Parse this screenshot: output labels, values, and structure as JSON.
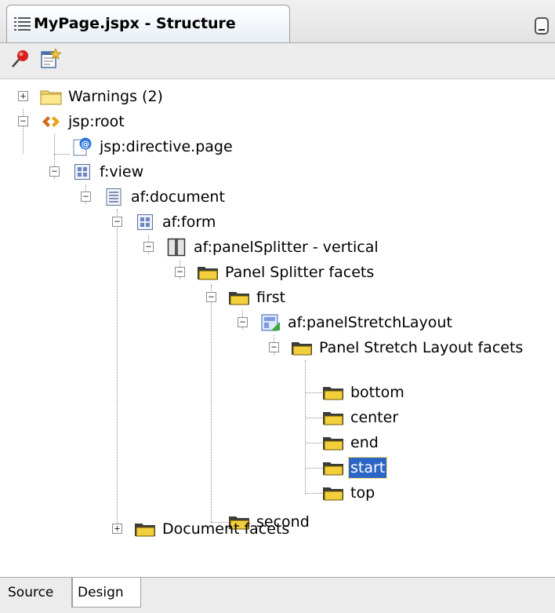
{
  "window": {
    "tab_title": "MyPage.jspx - Structure",
    "tab_icon": "structure-icon",
    "minimize_icon": "minimize-icon"
  },
  "toolbar": {
    "buttons": [
      {
        "icon": "pin-icon",
        "color": "#d42020"
      },
      {
        "icon": "new-view-icon",
        "color": "#f0c040"
      }
    ]
  },
  "tree": {
    "selected_color": "#2b65c6",
    "nodes": [
      {
        "label": "Warnings (2)",
        "icon": "folder-icon",
        "expander": "+"
      },
      {
        "label": "jsp:root",
        "icon": "xml-tag-icon",
        "expander": "-"
      },
      {
        "label": "jsp:directive.page",
        "icon": "directive-icon",
        "expander": ""
      },
      {
        "label": "f:view",
        "icon": "component-grid-icon",
        "expander": "-"
      },
      {
        "label": "af:document",
        "icon": "document-icon",
        "expander": "-"
      },
      {
        "label": "af:form",
        "icon": "component-grid-icon",
        "expander": "-"
      },
      {
        "label": "af:panelSplitter - vertical",
        "icon": "splitter-icon",
        "expander": "-"
      },
      {
        "label": "Panel Splitter facets",
        "icon": "facet-folder-icon",
        "expander": "-"
      },
      {
        "label": "first",
        "icon": "facet-folder-icon",
        "expander": "-"
      },
      {
        "label": "af:panelStretchLayout",
        "icon": "stretch-layout-icon",
        "expander": "-"
      },
      {
        "label": "Panel Stretch Layout facets",
        "icon": "facet-folder-icon",
        "expander": "-"
      },
      {
        "label": "bottom",
        "icon": "facet-folder-icon",
        "expander": ""
      },
      {
        "label": "center",
        "icon": "facet-folder-icon",
        "expander": ""
      },
      {
        "label": "end",
        "icon": "facet-folder-icon",
        "expander": ""
      },
      {
        "label": "start",
        "icon": "facet-folder-icon",
        "expander": "",
        "selected": true
      },
      {
        "label": "top",
        "icon": "facet-folder-icon",
        "expander": ""
      },
      {
        "label": "second",
        "icon": "facet-folder-icon",
        "expander": ""
      },
      {
        "label": "Document facets",
        "icon": "facet-folder-icon",
        "expander": "+"
      }
    ]
  },
  "bottom_tabs": {
    "source": "Source",
    "design": "Design"
  }
}
